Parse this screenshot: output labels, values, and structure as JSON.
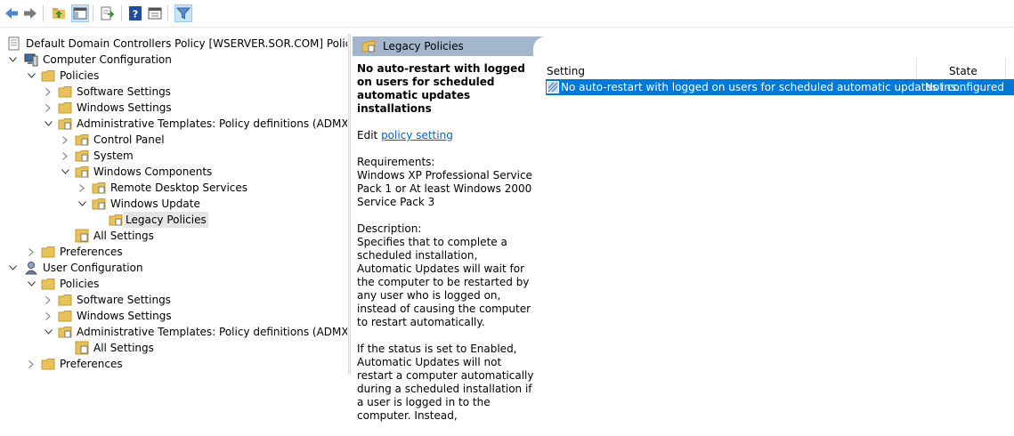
{
  "toolbar": {
    "buttons": [
      "back-icon",
      "forward-icon",
      "up-folder-icon",
      "show-hide-tree-icon",
      "export-list-icon",
      "help-icon",
      "properties-icon",
      "filter-icon"
    ]
  },
  "tree": {
    "root": "Default Domain Controllers Policy [WSERVER.SOR.COM] Policy",
    "computer_config": "Computer Configuration",
    "cc_policies": "Policies",
    "cc_software": "Software Settings",
    "cc_windows": "Windows Settings",
    "cc_admin": "Administrative Templates: Policy definitions (ADMX files)",
    "control_panel": "Control Panel",
    "system": "System",
    "windows_components": "Windows Components",
    "remote_desktop": "Remote Desktop Services",
    "windows_update": "Windows Update",
    "legacy_policies": "Legacy Policies",
    "cc_all_settings": "All Settings",
    "cc_preferences": "Preferences",
    "user_config": "User Configuration",
    "uc_policies": "Policies",
    "uc_software": "Software Settings",
    "uc_windows": "Windows Settings",
    "uc_admin": "Administrative Templates: Policy definitions (ADMX files)",
    "uc_all_settings": "All Settings",
    "uc_preferences": "Preferences"
  },
  "header": {
    "title": "Legacy Policies"
  },
  "description": {
    "title": "No auto-restart with logged on users for scheduled automatic updates installations",
    "edit_prefix": "Edit ",
    "edit_link": "policy setting",
    "requirements": "Requirements:\nWindows XP Professional Service Pack 1 or At least Windows 2000 Service Pack 3",
    "description": "Description:\nSpecifies that to complete a scheduled installation, Automatic Updates will wait for the computer to be restarted by any user who is logged on, instead of causing the computer to restart automatically.",
    "status": "If the status is set to Enabled, Automatic Updates will not restart a computer automatically during a scheduled installation if a user is logged in to the computer. Instead,"
  },
  "list": {
    "col_setting": "Setting",
    "col_state": "State",
    "rows": [
      {
        "setting": "No auto-restart with logged on users for scheduled automatic updates ins...",
        "state": "Not configured"
      }
    ]
  },
  "colors": {
    "selection": "#0078d7",
    "header": "#a3b6cb",
    "link": "#0066cc"
  }
}
